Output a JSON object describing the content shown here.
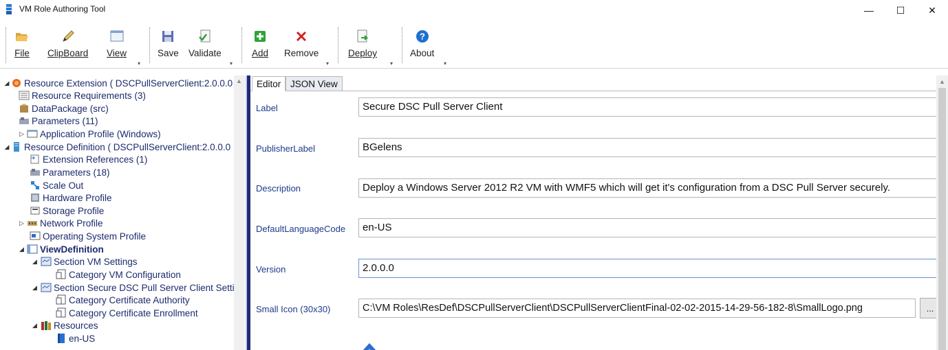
{
  "window": {
    "title": "VM Role Authoring Tool",
    "controls": {
      "minimize": "—",
      "maximize": "☐",
      "close": "✕"
    }
  },
  "ribbon": {
    "buttons": {
      "file": {
        "label": "File",
        "icon": "folder-open-icon"
      },
      "clipboard": {
        "label": "ClipBoard",
        "icon": "pencil-icon"
      },
      "view": {
        "label": "View",
        "icon": "window-icon"
      },
      "save": {
        "label": "Save",
        "icon": "floppy-disk-icon"
      },
      "validate": {
        "label": "Validate",
        "icon": "validate-document-icon"
      },
      "add": {
        "label": "Add",
        "icon": "green-plus-icon"
      },
      "remove": {
        "label": "Remove",
        "icon": "red-x-icon"
      },
      "deploy": {
        "label": "Deploy",
        "icon": "deploy-document-icon"
      },
      "about": {
        "label": "About",
        "icon": "blue-question-icon"
      }
    }
  },
  "tree": {
    "nodes": [
      {
        "label": "Resource Extension ( DSCPullServerClient:2.0.0.0",
        "expander": "◢",
        "icon": "resource-extension-icon"
      },
      {
        "label": "Resource Requirements (3)",
        "expander": "",
        "icon": "list-icon"
      },
      {
        "label": "DataPackage (src)",
        "expander": "",
        "icon": "package-icon"
      },
      {
        "label": "Parameters (11)",
        "expander": "",
        "icon": "parameters-icon"
      },
      {
        "label": "Application Profile (Windows)",
        "expander": "▷",
        "icon": "application-icon"
      },
      {
        "label": "Resource Definition ( DSCPullServerClient:2.0.0.0",
        "expander": "◢",
        "icon": "server-icon"
      },
      {
        "label": "Extension References (1)",
        "expander": "",
        "icon": "reference-icon"
      },
      {
        "label": "Parameters (18)",
        "expander": "",
        "icon": "parameters-icon"
      },
      {
        "label": "Scale Out",
        "expander": "",
        "icon": "scale-out-icon"
      },
      {
        "label": "Hardware Profile",
        "expander": "",
        "icon": "hardware-icon"
      },
      {
        "label": "Storage Profile",
        "expander": "",
        "icon": "storage-icon"
      },
      {
        "label": "Network Profile",
        "expander": "▷",
        "icon": "network-icon"
      },
      {
        "label": "Operating System Profile",
        "expander": "",
        "icon": "os-icon"
      },
      {
        "label": "ViewDefinition",
        "expander": "◢",
        "icon": "view-definition-icon"
      },
      {
        "label": "Section VM Settings",
        "expander": "◢",
        "icon": "section-icon"
      },
      {
        "label": "Category VM Configuration",
        "expander": "",
        "icon": "category-icon"
      },
      {
        "label": "Section Secure DSC Pull Server Client Setti",
        "expander": "◢",
        "icon": "section-icon"
      },
      {
        "label": "Category Certificate Authority",
        "expander": "",
        "icon": "category-icon"
      },
      {
        "label": "Category Certificate Enrollment",
        "expander": "",
        "icon": "category-icon"
      },
      {
        "label": "Resources",
        "expander": "◢",
        "icon": "books-icon"
      },
      {
        "label": "en-US",
        "expander": "",
        "icon": "book-icon"
      }
    ]
  },
  "editor": {
    "tabs": {
      "editor": "Editor",
      "json_view": "JSON View"
    },
    "fields": {
      "label": {
        "caption": "Label",
        "value": "Secure DSC Pull Server Client"
      },
      "publisher": {
        "caption": "PublisherLabel",
        "value": "BGelens"
      },
      "description": {
        "caption": "Description",
        "value": "Deploy a Windows Server 2012 R2 VM with WMF5 which will get it's configuration from a DSC Pull Server securely."
      },
      "language": {
        "caption": "DefaultLanguageCode",
        "value": "en-US"
      },
      "version": {
        "caption": "Version",
        "value": "2.0.0.0"
      },
      "small_icon": {
        "caption": "Small Icon (30x30)",
        "value": "C:\\VM Roles\\ResDef\\DSCPullServerClient\\DSCPullServerClientFinal-02-02-2015-14-29-56-182-8\\SmallLogo.png"
      }
    },
    "browse_label": "..."
  },
  "colors": {
    "tree_text": "#1b2a6b",
    "field_label": "#1e3a8a",
    "splitter": "#1e2a7a"
  }
}
